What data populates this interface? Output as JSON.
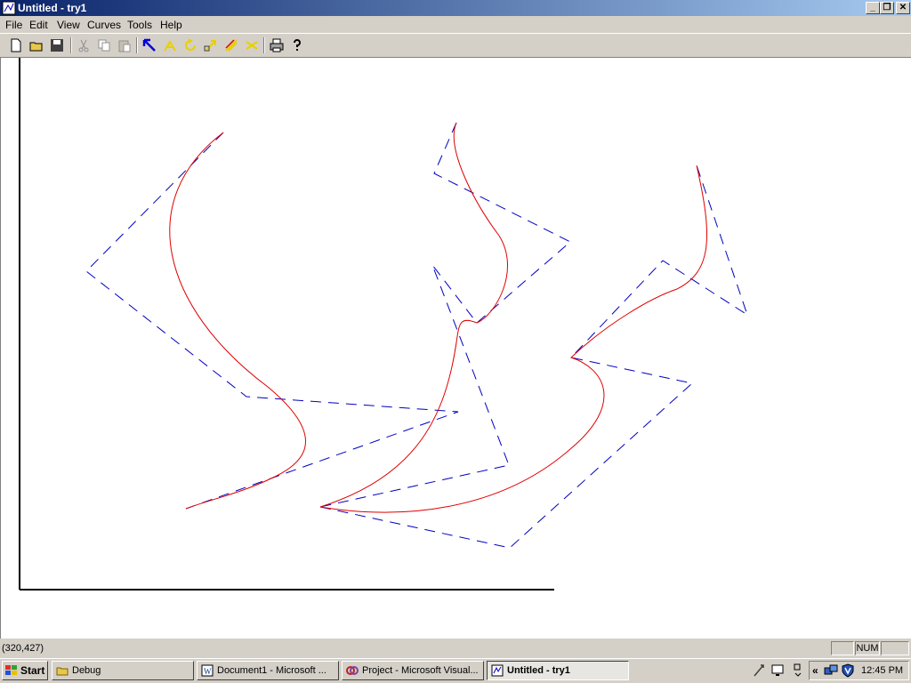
{
  "window": {
    "title": "Untitled - try1",
    "icon": "app-icon"
  },
  "menu": [
    "File",
    "Edit",
    "View",
    "Curves",
    "Tools",
    "Help"
  ],
  "toolbar": [
    "new-icon",
    "open-icon",
    "save-icon",
    "cut-icon",
    "copy-icon",
    "paste-icon",
    "select-arrow-icon",
    "add-point-icon",
    "rotate-icon",
    "scale-icon",
    "draw-curve-icon",
    "delete-icon",
    "print-icon",
    "help-icon"
  ],
  "status": {
    "coords": "(320,427)",
    "num": "NUM"
  },
  "taskbar": {
    "start": "Start",
    "tasks": [
      "Debug",
      "Document1 - Microsoft ...",
      "Project - Microsoft Visual...",
      "Untitled - try1"
    ],
    "clock": "12:45 PM"
  },
  "colors": {
    "curve": "#e00000",
    "polygon": "#0000c0",
    "axes": "#000000"
  }
}
